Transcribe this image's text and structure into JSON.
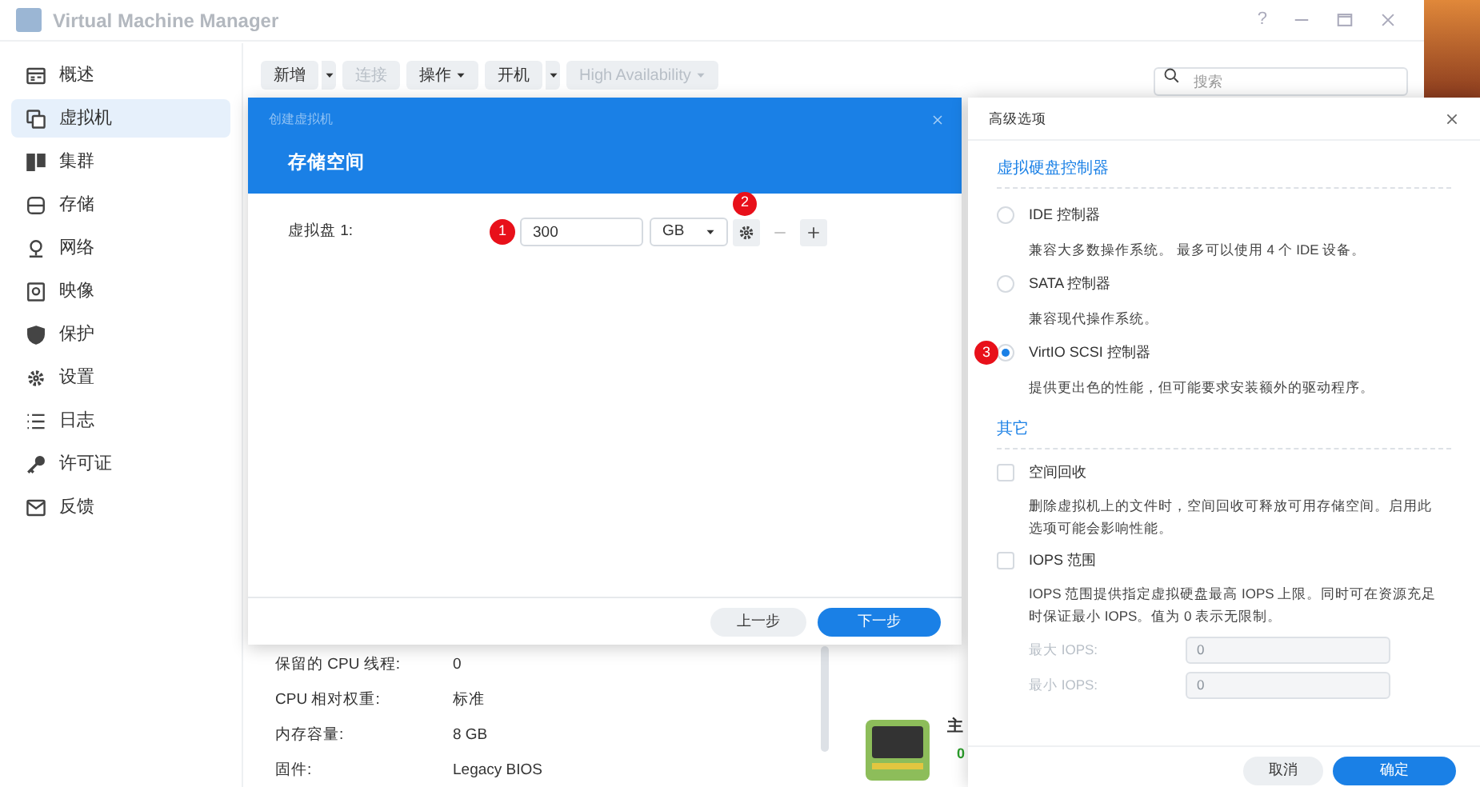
{
  "window": {
    "title": "Virtual Machine Manager",
    "help": "?"
  },
  "sidebar": {
    "items": [
      {
        "label": "概述",
        "selected": false
      },
      {
        "label": "虚拟机",
        "selected": true
      },
      {
        "label": "集群",
        "selected": false
      },
      {
        "label": "存储",
        "selected": false
      },
      {
        "label": "网络",
        "selected": false
      },
      {
        "label": "映像",
        "selected": false
      },
      {
        "label": "保护",
        "selected": false
      },
      {
        "label": "设置",
        "selected": false
      },
      {
        "label": "日志",
        "selected": false
      },
      {
        "label": "许可证",
        "selected": false
      },
      {
        "label": "反馈",
        "selected": false
      }
    ]
  },
  "toolbar": {
    "buttons": [
      {
        "label": "新增",
        "kind": "split",
        "disabled": false
      },
      {
        "label": "连接",
        "kind": "plain",
        "disabled": true
      },
      {
        "label": "操作",
        "kind": "dropdown",
        "disabled": false
      },
      {
        "label": "开机",
        "kind": "split",
        "disabled": false
      },
      {
        "label": "High Availability",
        "kind": "dropdown",
        "disabled": true
      }
    ],
    "search": {
      "placeholder": "搜索"
    }
  },
  "details": {
    "rows": [
      {
        "label": "保留的 CPU 线程:",
        "value": "0"
      },
      {
        "label": "CPU 相对权重:",
        "value": "标准"
      },
      {
        "label": "内存容量:",
        "value": "8 GB"
      },
      {
        "label": "固件:",
        "value": "Legacy BIOS"
      }
    ],
    "side_title": "主",
    "side_value": "0"
  },
  "wizard": {
    "title": "创建虚拟机",
    "step": "存储空间",
    "disk_label": "虚拟盘 1:",
    "size": "300",
    "unit": "GB",
    "size_marker": "1",
    "settings_marker": "2",
    "back": "上一步",
    "next": "下一步"
  },
  "advanced": {
    "title": "高级选项",
    "section_1": "虚拟硬盘控制器",
    "controllers": [
      {
        "label": "IDE 控制器",
        "description": "兼容大多数操作系统。 最多可以使用 4 个 IDE 设备。",
        "selected": false
      },
      {
        "label": "SATA 控制器",
        "description": "兼容现代操作系统。",
        "selected": false
      },
      {
        "label": "VirtIO SCSI 控制器",
        "description": "提供更出色的性能，但可能要求安装额外的驱动程序。",
        "selected": true,
        "marker": "3"
      }
    ],
    "section_2": "其它",
    "options": [
      {
        "label": "空间回收",
        "description": "删除虚拟机上的文件时，空间回收可释放可用存储空间。启用此选项可能会影响性能。",
        "checked": false
      },
      {
        "label": "IOPS 范围",
        "description": "IOPS 范围提供指定虚拟硬盘最高 IOPS 上限。同时可在资源充足时保证最小 IOPS。值为 0 表示无限制。",
        "checked": false
      }
    ],
    "iops_fields": [
      {
        "label": "最大 IOPS:",
        "value": "0",
        "disabled": true
      },
      {
        "label": "最小 IOPS:",
        "value": "0",
        "disabled": true
      }
    ],
    "cancel": "取消",
    "ok": "确定"
  }
}
